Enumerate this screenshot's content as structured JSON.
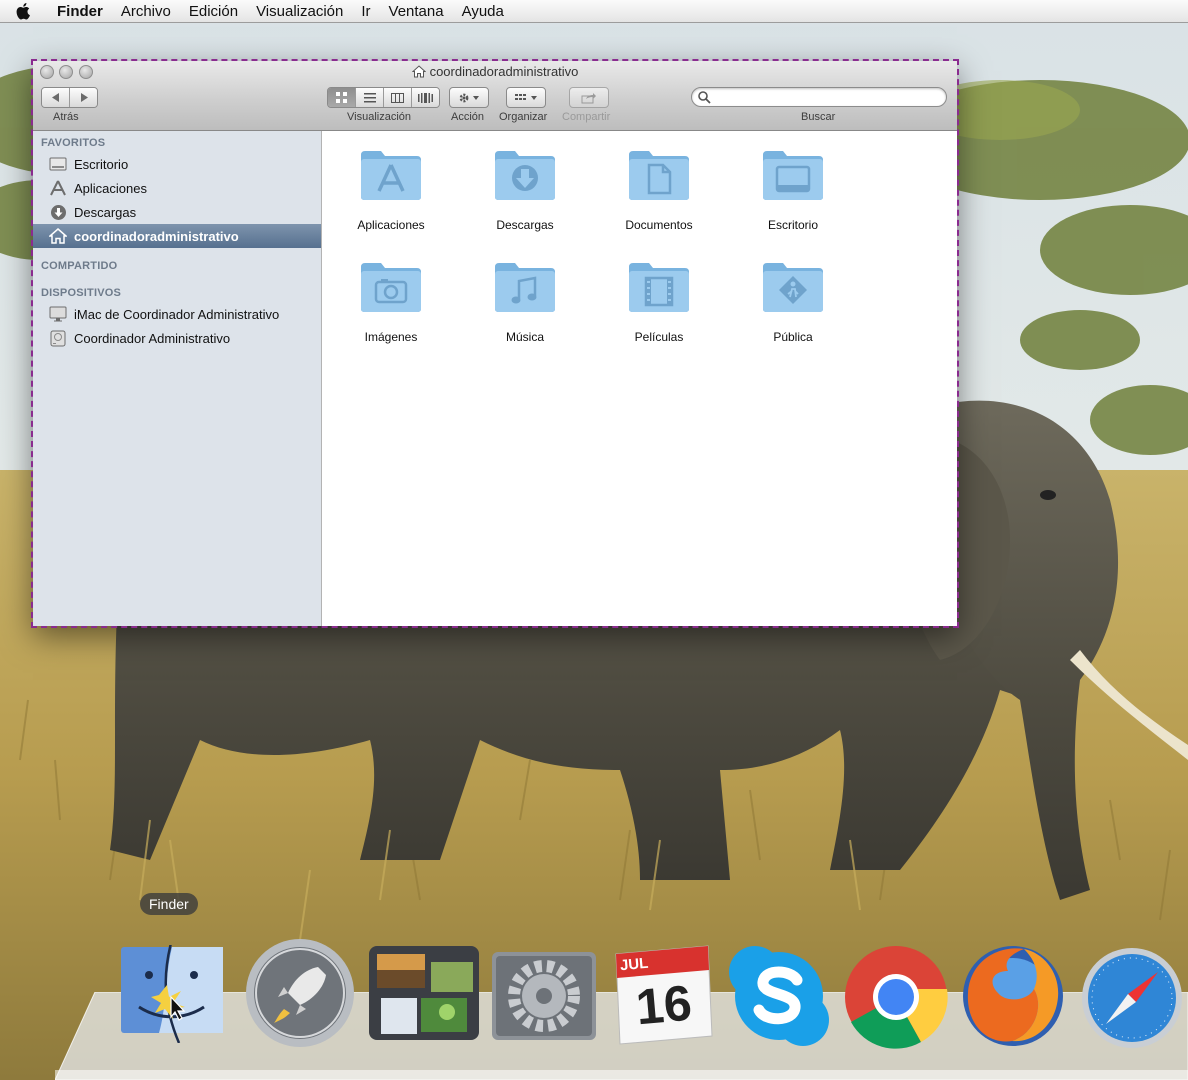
{
  "menubar": {
    "app": "Finder",
    "items": [
      "Archivo",
      "Edición",
      "Visualización",
      "Ir",
      "Ventana",
      "Ayuda"
    ]
  },
  "window": {
    "title": "coordinadoradministrativo",
    "toolbar": {
      "back_label": "Atrás",
      "view_label": "Visualización",
      "action_label": "Acción",
      "arrange_label": "Organizar",
      "share_label": "Compartir",
      "search_label": "Buscar",
      "search_placeholder": "",
      "view_mode_selected": "icons"
    },
    "sidebar": {
      "favorites_header": "FAVORITOS",
      "favorites": [
        {
          "label": "Escritorio",
          "icon": "desktop-icon"
        },
        {
          "label": "Aplicaciones",
          "icon": "applications-icon"
        },
        {
          "label": "Descargas",
          "icon": "downloads-icon"
        },
        {
          "label": "coordinadoradministrativo",
          "icon": "home-icon",
          "selected": true
        }
      ],
      "shared_header": "COMPARTIDO",
      "devices_header": "DISPOSITIVOS",
      "devices": [
        {
          "label": "iMac de Coordinador Administrativo",
          "icon": "imac-icon"
        },
        {
          "label": "Coordinador Administrativo",
          "icon": "harddisk-icon"
        }
      ]
    },
    "folders": [
      {
        "label": "Aplicaciones",
        "glyph": "applications-glyph"
      },
      {
        "label": "Descargas",
        "glyph": "downloads-glyph"
      },
      {
        "label": "Documentos",
        "glyph": "documents-glyph"
      },
      {
        "label": "Escritorio",
        "glyph": "desktop-glyph"
      },
      {
        "label": "Imágenes",
        "glyph": "camera-glyph"
      },
      {
        "label": "Música",
        "glyph": "music-glyph"
      },
      {
        "label": "Películas",
        "glyph": "film-glyph"
      },
      {
        "label": "Pública",
        "glyph": "public-glyph"
      }
    ]
  },
  "dock": {
    "tooltip": "Finder",
    "apps": [
      "Finder",
      "Launchpad",
      "Mission Control",
      "Preferencias del Sistema",
      "Calendario",
      "Skype",
      "Google Chrome",
      "Firefox",
      "Safari"
    ],
    "calendar_month": "JUL",
    "calendar_day": "16"
  },
  "colors": {
    "selection": "#5f7997",
    "sidebar_bg": "#dde3ea",
    "window_outline": "#8a2b8f",
    "folder_blue": "#8fc3e6"
  }
}
